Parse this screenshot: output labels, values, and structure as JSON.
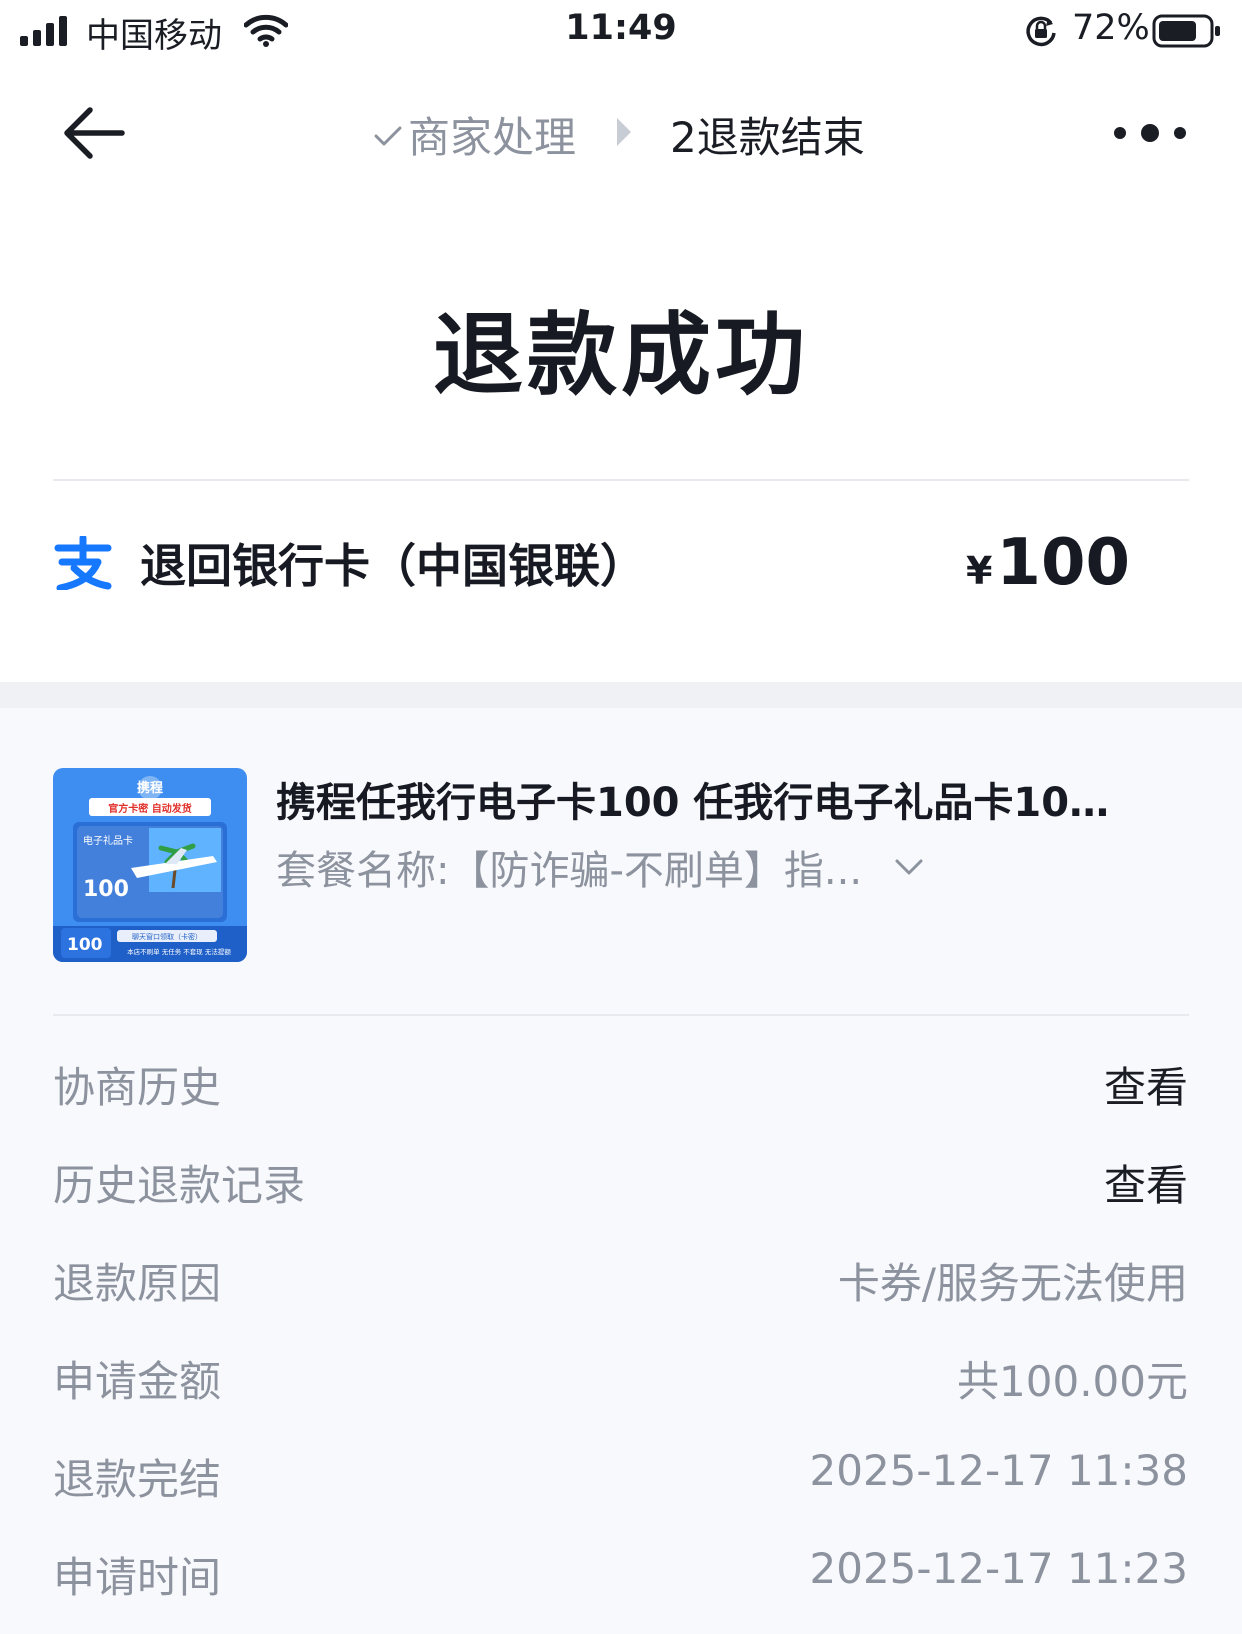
{
  "status_bar": {
    "carrier": "中国移动",
    "time": "11:49",
    "battery": "72%"
  },
  "nav": {
    "step_done": "商家处理",
    "step_current": "2退款结束"
  },
  "title": "退款成功",
  "refund": {
    "destination": "退回银行卡（中国银联）",
    "currency": "¥",
    "amount": "100"
  },
  "product": {
    "title": "携程任我行电子卡100 任我行电子礼品卡100...",
    "package": "套餐名称:【防诈骗-不刷单】指...",
    "thumb": {
      "brand": "携程",
      "banner": "官方卡密 自动发货",
      "card_label": "电子礼品卡",
      "card_value": "100",
      "bottom_value": "100",
      "note1": "聊天窗口领取（卡密）",
      "note2": "本店不刷单 无任务 不套现 无法提额"
    }
  },
  "rows": [
    {
      "label": "协商历史",
      "value": "查看",
      "link": true
    },
    {
      "label": "历史退款记录",
      "value": "查看",
      "link": true
    },
    {
      "label": "退款原因",
      "value": "卡券/服务无法使用",
      "link": false
    },
    {
      "label": "申请金额",
      "value": "共100.00元",
      "link": false
    },
    {
      "label": "退款完结",
      "value": "2025-12-17 11:38",
      "link": false
    },
    {
      "label": "申请时间",
      "value": "2025-12-17 11:23",
      "link": false
    }
  ],
  "colors": {
    "accent": "#1677ff",
    "text": "#171a22",
    "muted": "#8c929e"
  }
}
